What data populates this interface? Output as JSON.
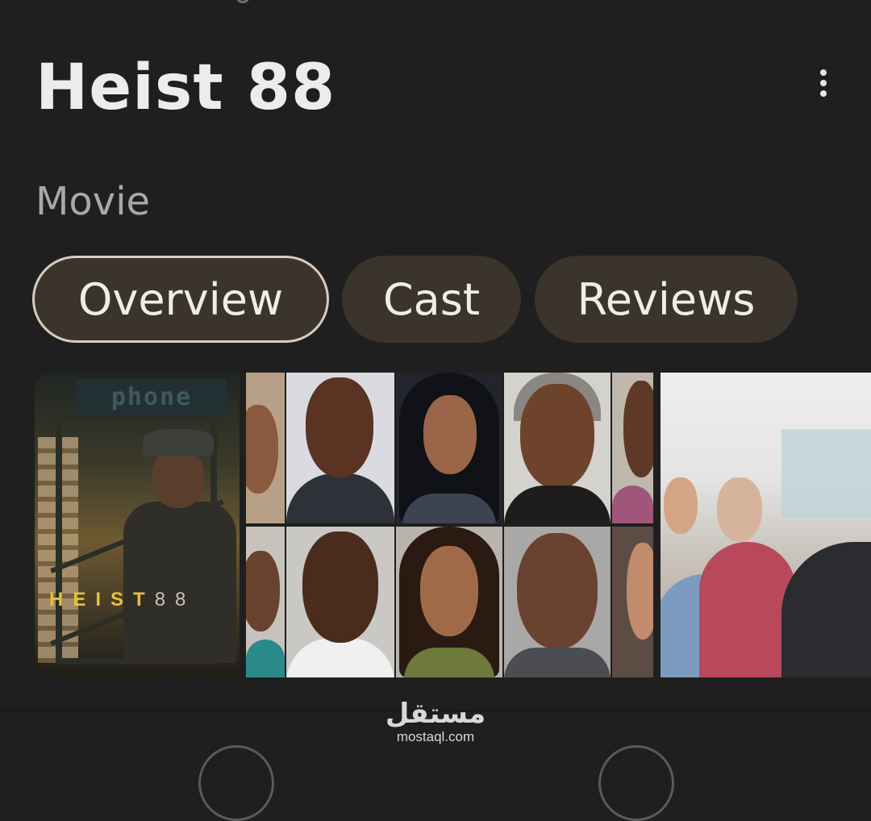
{
  "title": "Heist 88",
  "subtitle": "Movie",
  "tabs": [
    {
      "label": "Overview",
      "active": true
    },
    {
      "label": "Cast",
      "active": false
    },
    {
      "label": "Reviews",
      "active": false
    }
  ],
  "poster": {
    "sign": "phone",
    "title_highlight": "HEIST",
    "title_suffix": "88"
  },
  "watermark": {
    "arabic": "مستقل",
    "latin": "mostaql.com"
  },
  "colors": {
    "background": "#1f1f1f",
    "tab_fill": "#3a342c",
    "tab_active_border": "#d7cdbb",
    "poster_title": "#e4c23a"
  },
  "icons": [
    "more-vert-icon"
  ]
}
